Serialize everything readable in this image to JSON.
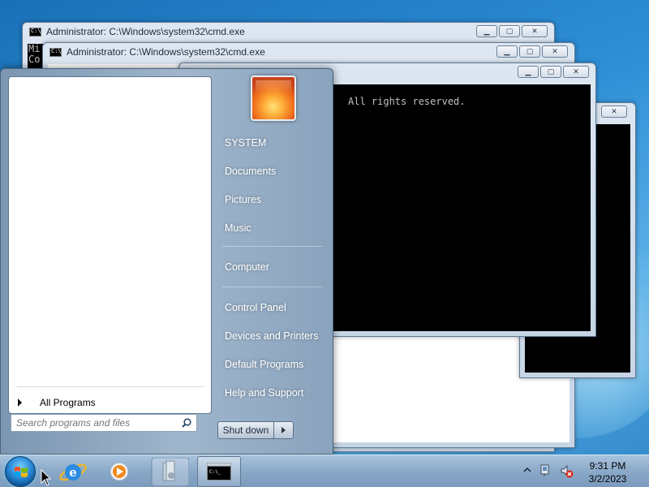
{
  "windows": [
    {
      "title": "Administrator: C:\\Windows\\system32\\cmd.exe",
      "console_text": "Mi\nCo"
    },
    {
      "title": "Administrator: C:\\Windows\\system32\\cmd.exe"
    },
    {
      "title": "",
      "console_text": "All rights reserved."
    },
    {
      "title": ""
    }
  ],
  "caption_buttons": {
    "minimize": "▁",
    "maximize": "▢",
    "close": "✕"
  },
  "start_menu": {
    "all_programs_label": "All Programs",
    "search_placeholder": "Search programs and files",
    "right_items": {
      "user": "SYSTEM",
      "documents": "Documents",
      "pictures": "Pictures",
      "music": "Music",
      "computer": "Computer",
      "control_panel": "Control Panel",
      "devices_printers": "Devices and Printers",
      "default_programs": "Default Programs",
      "help_support": "Help and Support"
    },
    "shutdown_label": "Shut down"
  },
  "taskbar": {
    "pinned": [
      "start-orb",
      "internet-explorer-icon",
      "media-player-icon",
      "library-icon",
      "command-prompt-icon"
    ],
    "clock": {
      "time": "9:31 PM",
      "date": "3/2/2023"
    }
  },
  "colors": {
    "accent": "#2a8ad6",
    "console_bg": "#000000",
    "console_text": "#c0c0c0"
  }
}
